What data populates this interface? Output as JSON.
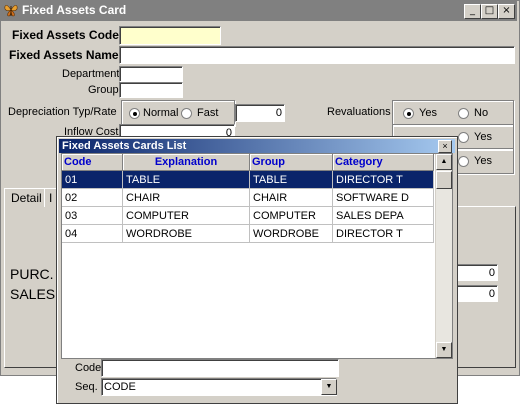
{
  "main_window": {
    "title": "Fixed Assets Card",
    "min_glyph": "_",
    "max_glyph": "□",
    "close_glyph": "×"
  },
  "form": {
    "code_label": "Fixed Assets Code",
    "code_value": "",
    "name_label": "Fixed Assets Name",
    "department_label": "Department",
    "group_label": "Group",
    "depreciation_label": "Depreciation Typ/Rate",
    "normal_label": "Normal",
    "fast_label": "Fast",
    "rate_value": "0",
    "revaluations_label": "Revaluations",
    "yes_label": "Yes",
    "no_label": "No",
    "inflow_label": "Inflow Cost",
    "inflow_value": "0",
    "yes2_label": "Yes",
    "yes3_label": "Yes",
    "purc_label": "PURC.",
    "purc_value": "0",
    "sales_label": "SALES",
    "sales_value": "0"
  },
  "tabs": [
    "Detail",
    "I"
  ],
  "dialog": {
    "title": "Fixed Assets Cards List",
    "close_glyph": "×",
    "columns": [
      "Code",
      "Explanation",
      "Group",
      "Category"
    ],
    "rows": [
      [
        "01",
        "TABLE",
        "TABLE",
        "DIRECTOR T"
      ],
      [
        "02",
        "CHAIR",
        "CHAIR",
        "SOFTWARE D"
      ],
      [
        "03",
        "COMPUTER",
        "COMPUTER",
        "SALES DEPA"
      ],
      [
        "04",
        "WORDROBE",
        "WORDROBE",
        "DIRECTOR T"
      ]
    ],
    "selected_row": 0,
    "code_label": "Code",
    "code_value": "",
    "seq_label": "Seq.",
    "seq_value": "CODE"
  }
}
